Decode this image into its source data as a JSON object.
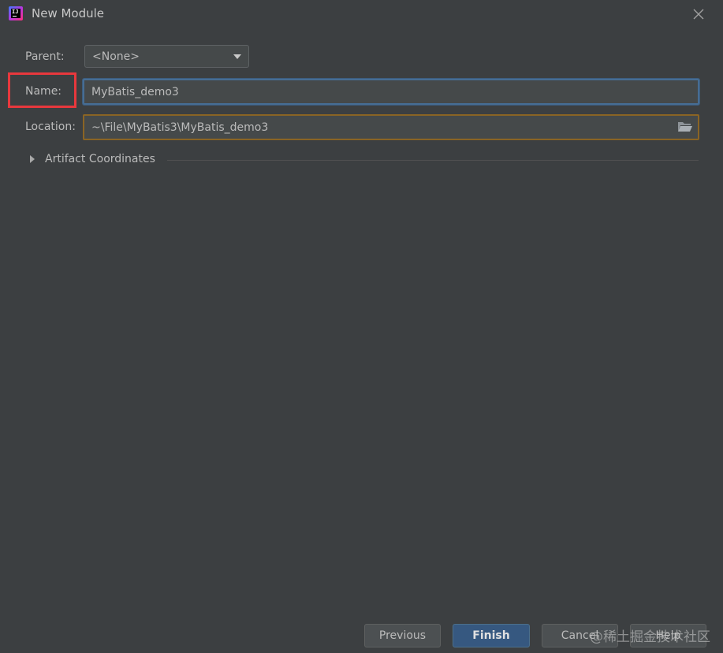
{
  "window": {
    "title": "New Module",
    "app_icon": "intellij-idea-icon"
  },
  "form": {
    "parent": {
      "label": "Parent:",
      "selected": "<None>"
    },
    "name": {
      "label": "Name:",
      "value": "MyBatis_demo3"
    },
    "location": {
      "label": "Location:",
      "value": "~\\File\\MyBatis3\\MyBatis_demo3"
    },
    "artifact_coordinates": {
      "label": "Artifact Coordinates",
      "expanded": false
    }
  },
  "buttons": {
    "previous": "Previous",
    "finish": "Finish",
    "cancel": "Cancel",
    "help": "Help"
  },
  "watermark": "@稀土掘金技术社区",
  "colors": {
    "background": "#3c3f41",
    "highlight_box": "#e8383d",
    "focus_border": "#466d94",
    "location_border": "#8a6424",
    "default_button": "#365880"
  }
}
